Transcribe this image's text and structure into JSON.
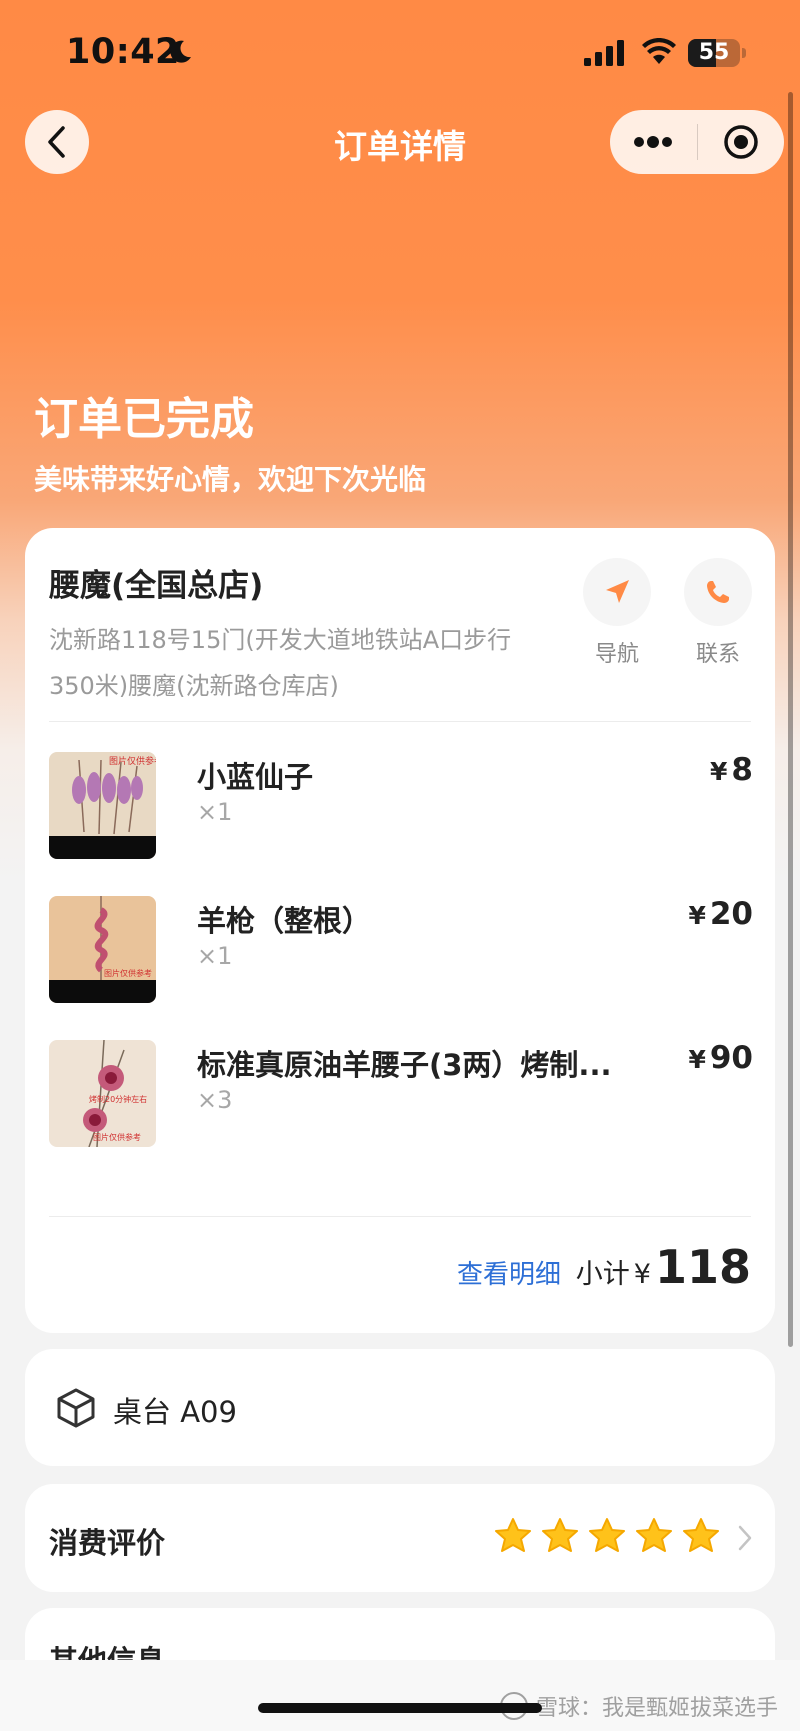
{
  "status_bar": {
    "time": "10:42",
    "battery": "55"
  },
  "nav": {
    "title": "订单详情"
  },
  "order_status": {
    "title": "订单已完成",
    "subtitle": "美味带来好心情，欢迎下次光临"
  },
  "store": {
    "name": "腰魔(全国总店)",
    "address": "沈新路118号15门(开发大道地铁站A口步行350米)腰魔(沈新路仓库店)",
    "nav_label": "导航",
    "contact_label": "联系"
  },
  "items": [
    {
      "name": "小蓝仙子",
      "qty": "×1",
      "currency": "¥",
      "price": "8",
      "thumb_note": "图片仅供参考"
    },
    {
      "name": "羊枪（整根）",
      "qty": "×1",
      "currency": "¥",
      "price": "20",
      "thumb_note": "图片仅供参考"
    },
    {
      "name": "标准真原油羊腰子(3两）烤制...",
      "qty": "×3",
      "currency": "¥",
      "price": "90",
      "thumb_note": "图片仅供参考",
      "thumb_note2": "烤制20分钟左右"
    }
  ],
  "summary": {
    "detail_link": "查看明细",
    "subtotal_label": "小计",
    "currency": "¥",
    "subtotal": "118"
  },
  "table": {
    "label": "桌台 A09"
  },
  "review": {
    "label": "消费评价",
    "stars": 5,
    "max_stars": 5
  },
  "other": {
    "label": "其他信息"
  },
  "watermark": "雪球：我是甄姬拔菜选手",
  "colors": {
    "accent": "#ff8a45",
    "link": "#2d6fd6",
    "star": "#ffc21a"
  }
}
